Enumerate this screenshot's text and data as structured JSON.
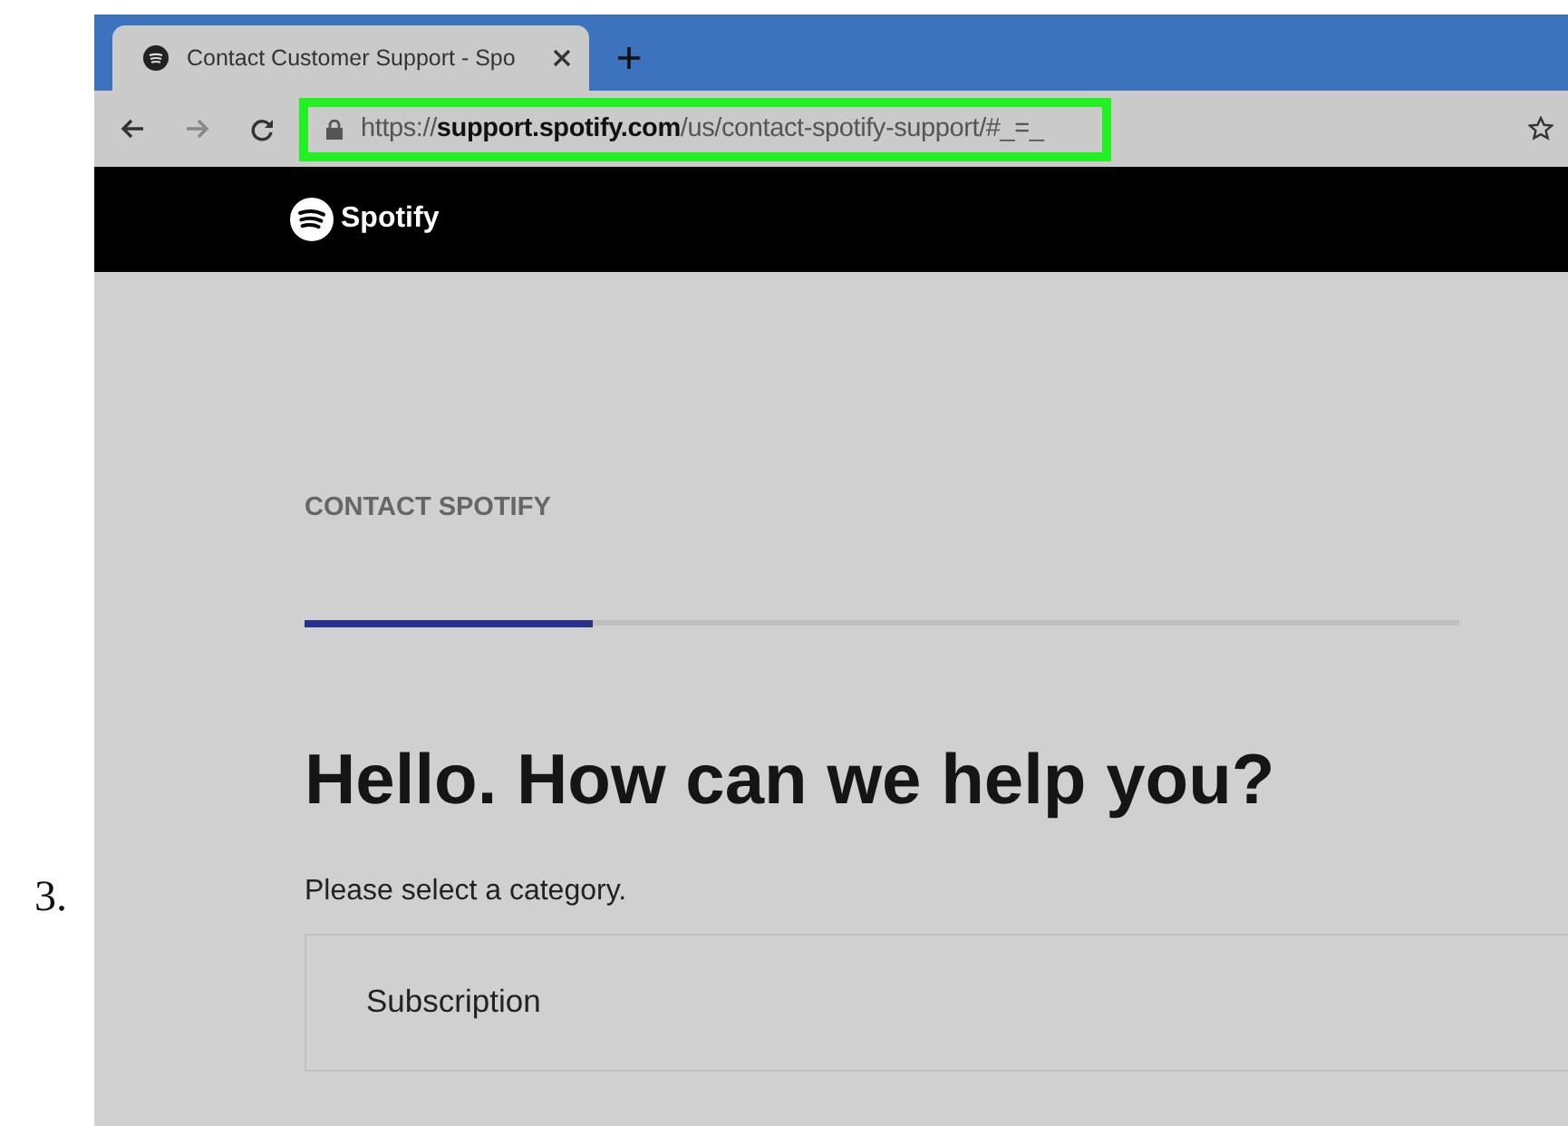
{
  "step_number": "3.",
  "browser": {
    "tab": {
      "title": "Contact Customer Support - Spo",
      "selected": true
    },
    "address_bar": {
      "url": "https://**support.spotify.com**/us/contact-spotify-support/#_=_",
      "highlighted": true
    }
  },
  "site_header": {
    "brand": "Spotify"
  },
  "page": {
    "eyebrow": "CONTACT SPOTIFY",
    "progress": {
      "level": 0.25
    },
    "heading": "Hello. How can we help you?",
    "prompt": "Please select a category.",
    "categories": [
      {
        "label": "Subscription"
      }
    ]
  }
}
